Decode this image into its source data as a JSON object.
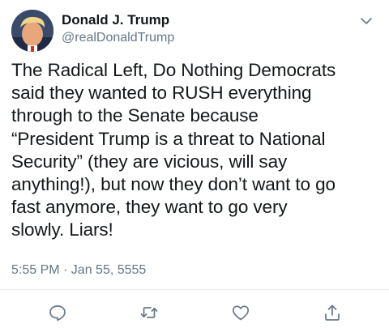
{
  "tweet": {
    "author": {
      "display_name": "Donald J. Trump",
      "handle": "@realDonaldTrump"
    },
    "text": "The Radical Left, Do Nothing Democrats\nsaid they wanted to RUSH everything\nthrough to the Senate because\n“President Trump is a threat to National\nSecurity” (they are vicious, will say\nanything!), but now they don’t want to go\nfast anymore, they want to go very\nslowly. Liars!",
    "timestamp": "5:55 PM · Jan 55, 5555"
  },
  "icons": {
    "menu": "chevron-down-icon",
    "reply": "reply-icon",
    "retweet": "retweet-icon",
    "like": "heart-icon",
    "share": "share-icon"
  },
  "colors": {
    "text": "#14171a",
    "secondary": "#657786",
    "icon": "#657786",
    "divider": "#e6ecf0"
  }
}
